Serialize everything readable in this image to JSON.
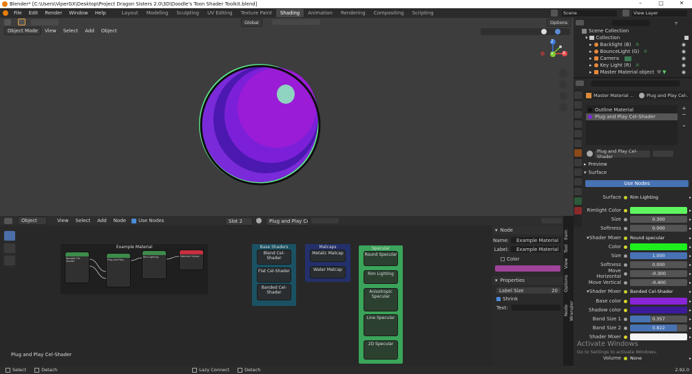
{
  "window": {
    "title": "Blender* [C:\\Users\\ViperGX\\Desktop\\Project Dragon Sisters 2.0\\3D\\Doodle's Toon Shader Toolkit.blend]"
  },
  "menu": [
    "File",
    "Edit",
    "Render",
    "Window",
    "Help"
  ],
  "workspaces": [
    "Layout",
    "Modeling",
    "Sculpting",
    "UV Editing",
    "Texture Paint",
    "Shading",
    "Animation",
    "Rendering",
    "Compositing",
    "Scripting"
  ],
  "active_workspace": "Shading",
  "scene": {
    "label": "Scene",
    "view_layer": "View Layer"
  },
  "viewport": {
    "mode": "Object Mode",
    "menus": [
      "View",
      "Select",
      "Add",
      "Object"
    ],
    "orientation": "Global",
    "options": "Options"
  },
  "gizmo": {
    "x": "X",
    "y": "Y",
    "z": "Z"
  },
  "outliner": {
    "root": "Scene Collection",
    "collection": "Collection",
    "items": [
      "Backlight (B)",
      "BounceLight (G)",
      "Camera",
      "Key Light (R)",
      "Master Material object"
    ]
  },
  "node_editor": {
    "editor": "Object",
    "menus": [
      "View",
      "Select",
      "Add",
      "Node"
    ],
    "use_nodes": "Use Nodes",
    "slot": "Slot 2",
    "material": "Plug and Play Cel-Sh...",
    "footer": "Plug and Play Cel-Shader"
  },
  "frames": {
    "example": {
      "title": "Example Material",
      "n1": "Banded Cel-Shader",
      "n2": "Plug and Play",
      "n3": "Rim Lighting",
      "n4": "Material Output"
    },
    "base": {
      "title": "Base Shaders",
      "items": [
        "Blend Cel-Shader",
        "Flat Cel-Shader",
        "Banded Cel-Shader"
      ]
    },
    "matcaps": {
      "title": "Matcaps",
      "items": [
        "Metalic Matcap",
        "Water Matcap"
      ]
    },
    "specular": {
      "title": "Specular",
      "items": [
        "Round Specular",
        "Rim Lighting",
        "Anisotropic Specular",
        "Line Specular",
        "2D Specular"
      ]
    }
  },
  "node_panel": {
    "header": "Node",
    "name_label": "Name:",
    "name": "Example Material",
    "label_label": "Label:",
    "label": "Example Material",
    "color": "Color",
    "properties": "Properties",
    "label_size_label": "Label Size",
    "label_size": "20",
    "shrink": "Shrink",
    "text_label": "Text:",
    "tabs": [
      "Item",
      "Tool",
      "View",
      "Options",
      "Node Wrangler"
    ],
    "swatch": "#a0449a"
  },
  "material": {
    "slots": [
      "Outline Material",
      "Plug and Play Cel-Shader"
    ],
    "tab_left": "Master Material ...",
    "tab_right": "Plug and Play Cel-...",
    "name": "Plug and Play Cel-Shader",
    "preview": "Preview",
    "surface": "Surface",
    "use_nodes": "Use Nodes",
    "rows": [
      {
        "label": "Surface",
        "value": "Rim Lighting",
        "kind": "link"
      },
      {
        "label": "Rimlight Color",
        "value": "",
        "kind": "color",
        "color": "#5ef55e"
      },
      {
        "label": "Size",
        "value": "0.300",
        "kind": "num"
      },
      {
        "label": "Softness",
        "value": "0.000",
        "kind": "num"
      },
      {
        "label": "Shader Mixer",
        "value": "Round specular",
        "kind": "link"
      },
      {
        "label": "Color",
        "value": "",
        "kind": "color",
        "color": "#1ef01e"
      },
      {
        "label": "Size",
        "value": "1.000",
        "kind": "numblue"
      },
      {
        "label": "Softness",
        "value": "0.000",
        "kind": "num"
      },
      {
        "label": "Move Horizontal",
        "value": "-0.300",
        "kind": "num"
      },
      {
        "label": "Move Vertical",
        "value": "-0.400",
        "kind": "num"
      },
      {
        "label": "Shader Mixer",
        "value": "Banded Cel-Shader",
        "kind": "link"
      },
      {
        "label": "Base color",
        "value": "",
        "kind": "color",
        "color": "#8b23d6"
      },
      {
        "label": "Shadow color",
        "value": "",
        "kind": "color",
        "color": "#3c1a9a"
      },
      {
        "label": "Band Size 1",
        "value": "0.357",
        "kind": "numblue"
      },
      {
        "label": "Band Size 2",
        "value": "0.822",
        "kind": "numblue"
      },
      {
        "label": "Shader Mixer",
        "value": "",
        "kind": "color",
        "color": "#f4f4f4"
      },
      {
        "label": "Volume",
        "value": "None",
        "kind": "link"
      }
    ]
  },
  "status": {
    "select": "Select",
    "detach": "Detach",
    "lazy_connect": "Lazy Connect",
    "detach2": "Detach",
    "version": "2.92.0",
    "activate": "Activate Windows",
    "activate_sub": "Go to Settings to activate Windows."
  }
}
